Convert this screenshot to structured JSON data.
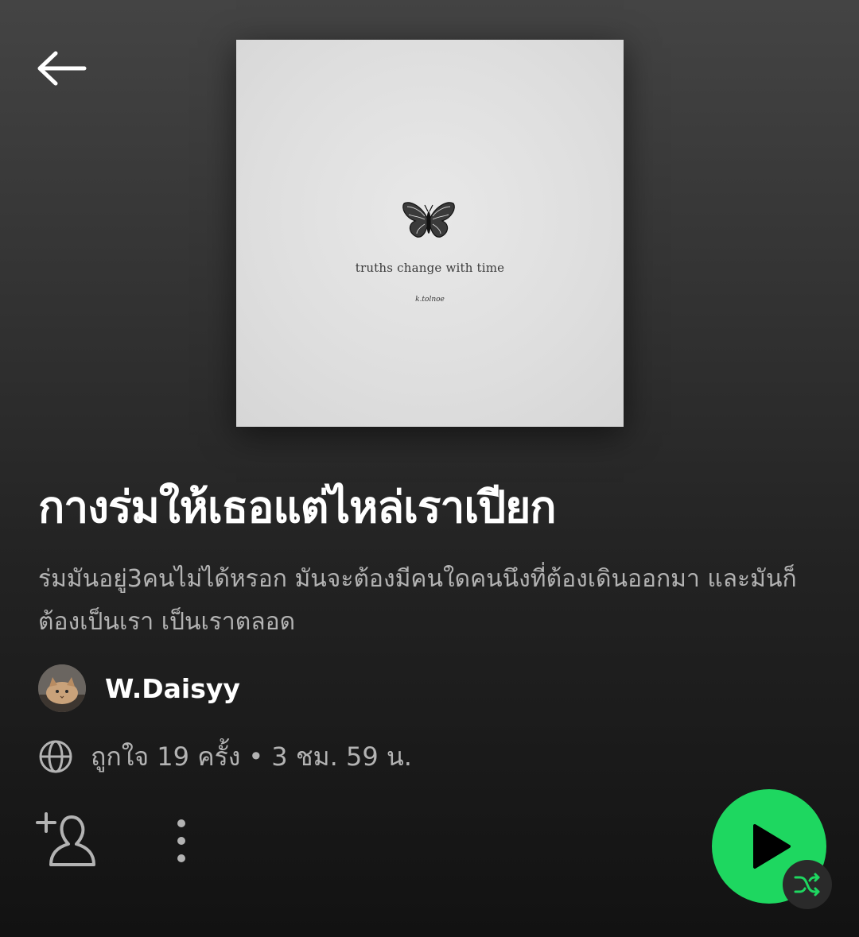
{
  "header": {
    "back_icon": "arrow-left-icon"
  },
  "cover": {
    "image": "playlist-cover-butterfly",
    "text": "truths change with time",
    "author": "k.tolnoe"
  },
  "playlist": {
    "title": "กางร่มให้เธอแต่ไหล่เราเปียก",
    "description": "ร่มมันอยู่3คนไม่ได้หรอก มันจะต้องมีคนใดคนนึงที่ต้องเดินออกมา และมันก็ต้องเป็นเรา เป็นเราตลอด",
    "owner": "W.Daisyy",
    "visibility_icon": "globe-icon",
    "likes_text": "ถูกใจ 19 ครั้ง",
    "separator": "•",
    "duration_text": "3 ชม. 59 น."
  },
  "actions": {
    "follow_icon": "add-user-icon",
    "more_icon": "more-vertical-icon",
    "play_icon": "play-icon",
    "shuffle_icon": "shuffle-icon"
  },
  "colors": {
    "accent": "#1ed760",
    "text_primary": "#ffffff",
    "text_secondary": "#b3b3b3"
  }
}
